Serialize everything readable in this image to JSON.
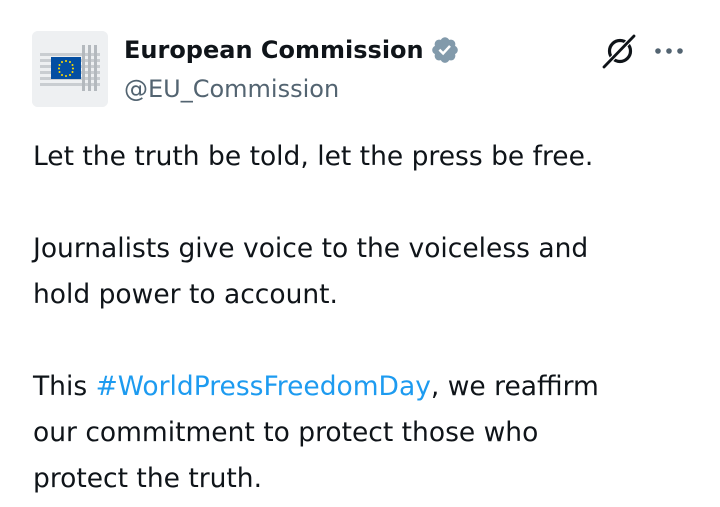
{
  "author": {
    "display_name": "European Commission",
    "handle": "@EU_Commission",
    "verified": true
  },
  "tweet": {
    "line1": "Let the truth be told, let the press be free.",
    "para2_line1": "Journalists give voice to the voiceless and",
    "para2_line2": "hold power to account.",
    "para3_prefix": "This ",
    "hashtag": "#WorldPressFreedomDay",
    "para3_suffix": ", we reaffirm",
    "para3_line2": "our commitment to protect those who",
    "para3_line3": "protect the truth."
  },
  "icons": {
    "verified": "verified-badge-icon",
    "grok": "grok-icon",
    "more": "more-options-icon"
  },
  "colors": {
    "text": "#0f1419",
    "secondary": "#536471",
    "link": "#1d9bf0",
    "verified_badge": "#829aab",
    "eu_blue": "#034ea2",
    "eu_yellow": "#ffdd00"
  }
}
